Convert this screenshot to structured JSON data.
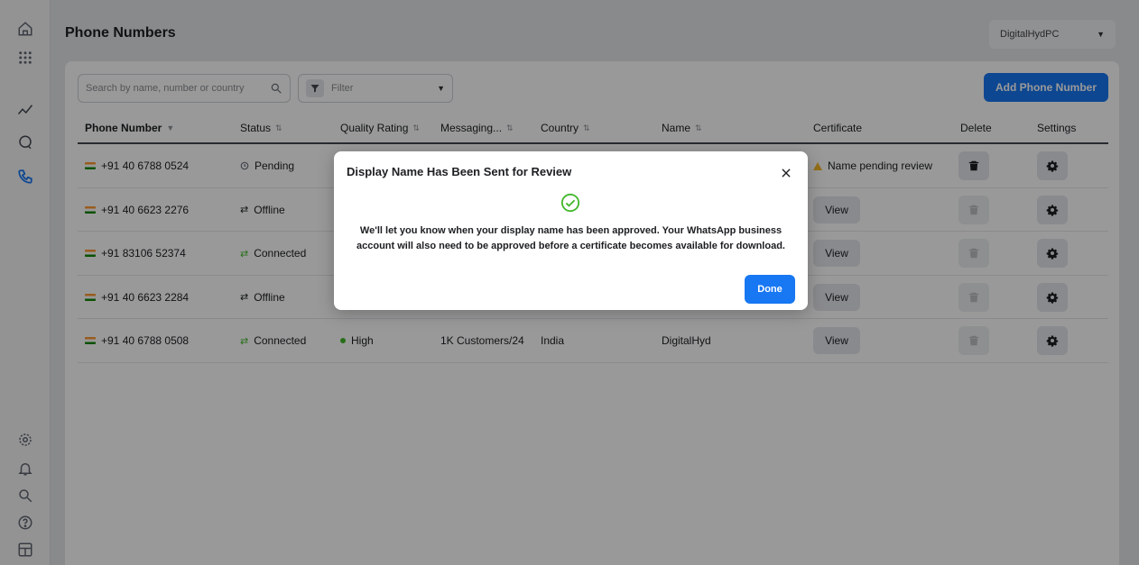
{
  "rail": {
    "top": [
      "home-icon",
      "apps-grid-icon",
      "insights-icon",
      "chat-icon",
      "phone-icon"
    ],
    "bottom": [
      "settings-icon",
      "notifications-icon",
      "search-icon",
      "help-icon",
      "layout-icon"
    ],
    "active": "phone-icon"
  },
  "header": {
    "title": "Phone Numbers",
    "account": "DigitalHydPC"
  },
  "toolbar": {
    "search_placeholder": "Search by name, number or country",
    "filter_label": "Filter",
    "add_button": "Add Phone Number"
  },
  "table": {
    "columns": [
      {
        "key": "phone",
        "label": "Phone Number",
        "sort": "▼"
      },
      {
        "key": "status",
        "label": "Status",
        "sort": "⇅"
      },
      {
        "key": "quality",
        "label": "Quality Rating",
        "sort": "⇅"
      },
      {
        "key": "messaging",
        "label": "Messaging...",
        "sort": "⇅"
      },
      {
        "key": "country",
        "label": "Country",
        "sort": "⇅"
      },
      {
        "key": "name",
        "label": "Name",
        "sort": "⇅"
      },
      {
        "key": "certificate",
        "label": "Certificate",
        "sort": ""
      },
      {
        "key": "delete",
        "label": "Delete",
        "sort": ""
      },
      {
        "key": "settings",
        "label": "Settings",
        "sort": ""
      }
    ],
    "rows": [
      {
        "phone": "+91 40 6788 0524",
        "status": "Pending",
        "status_icon": "clock-icon",
        "quality": "",
        "messaging": "",
        "country": "",
        "name": "",
        "certificate": "Name pending review",
        "cert_type": "warning",
        "delete_enabled": true
      },
      {
        "phone": "+91 40 6623 2276",
        "status": "Offline",
        "status_icon": "arrows-icon",
        "quality": "",
        "messaging": "",
        "country": "",
        "name": "",
        "certificate": "View",
        "cert_type": "button",
        "delete_enabled": false
      },
      {
        "phone": "+91 83106 52374",
        "status": "Connected",
        "status_icon": "arrows-icon",
        "quality": "",
        "messaging": "",
        "country": "",
        "name": "",
        "certificate": "View",
        "cert_type": "button",
        "delete_enabled": false
      },
      {
        "phone": "+91 40 6623 2284",
        "status": "Offline",
        "status_icon": "arrows-icon",
        "quality": "",
        "messaging": "",
        "country": "",
        "name": "",
        "certificate": "View",
        "cert_type": "button",
        "delete_enabled": false
      },
      {
        "phone": "+91 40 6788 0508",
        "status": "Connected",
        "status_icon": "arrows-icon",
        "quality": "High",
        "messaging": "1K Customers/24",
        "country": "India",
        "name": "DigitalHyd",
        "certificate": "View",
        "cert_type": "button",
        "delete_enabled": false
      }
    ]
  },
  "colors": {
    "accent": "#1877f2",
    "status_connected": "#42b72a",
    "quality_high": "#42b72a",
    "warning": "#f7b928"
  },
  "dialog": {
    "title": "Display Name Has Been Sent for Review",
    "body": "We'll let you know when your display name has been approved. Your WhatsApp business account will also need to be approved before a certificate becomes available for download.",
    "done_label": "Done"
  }
}
